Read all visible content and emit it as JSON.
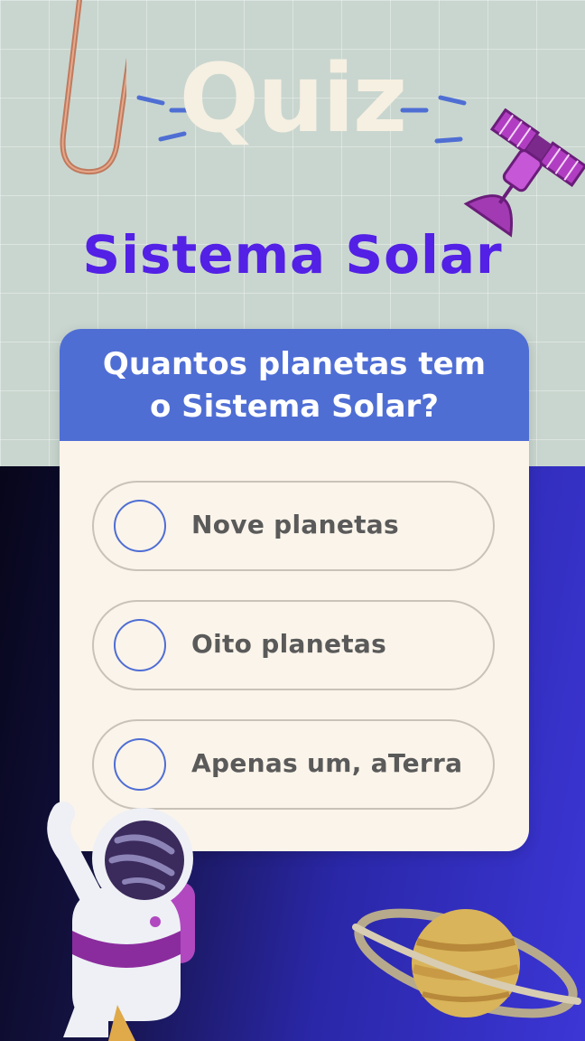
{
  "header": {
    "title": "Quiz",
    "subtitle": "Sistema Solar"
  },
  "question": {
    "line1": "Quantos planetas tem",
    "line2": "o Sistema Solar?"
  },
  "options": [
    {
      "label": "Nove planetas"
    },
    {
      "label": "Oito planetas"
    },
    {
      "label": "Apenas um, aTerra"
    }
  ],
  "colors": {
    "accent": "#5320e6",
    "question_header": "#4f6ed4",
    "card": "#fbf4ea",
    "title": "#f6f0e2",
    "grid_bg": "#c9d6cf",
    "space_bg": "#3c36d6"
  }
}
